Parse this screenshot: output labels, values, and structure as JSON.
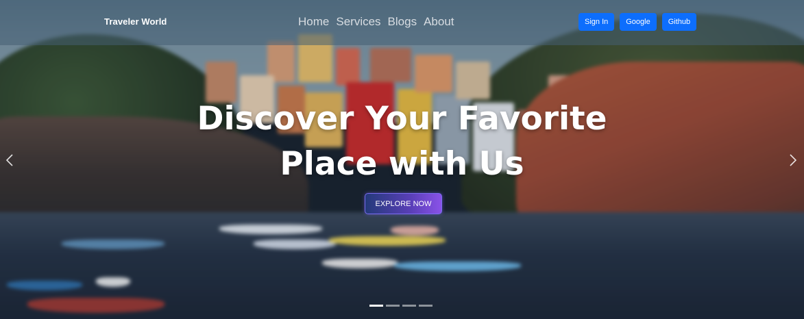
{
  "navbar": {
    "brand": "Traveler World",
    "links": [
      "Home",
      "Services",
      "Blogs",
      "About"
    ],
    "buttons": [
      "Sign In",
      "Google",
      "Github"
    ]
  },
  "hero": {
    "headline_line1": "Discover Your Favorite",
    "headline_line2": "Place with Us",
    "cta_label": "EXPLORE NOW",
    "carousel": {
      "slide_count": 4,
      "active_slide": 1,
      "prev_icon": "chevron-left-icon",
      "next_icon": "chevron-right-icon"
    }
  },
  "colors": {
    "primary_button": "#0d6efd",
    "cta_gradient_start": "#243a7a",
    "cta_gradient_end": "#8a52e8",
    "navbar_overlay": "rgba(70, 95, 115, 0.55)"
  }
}
